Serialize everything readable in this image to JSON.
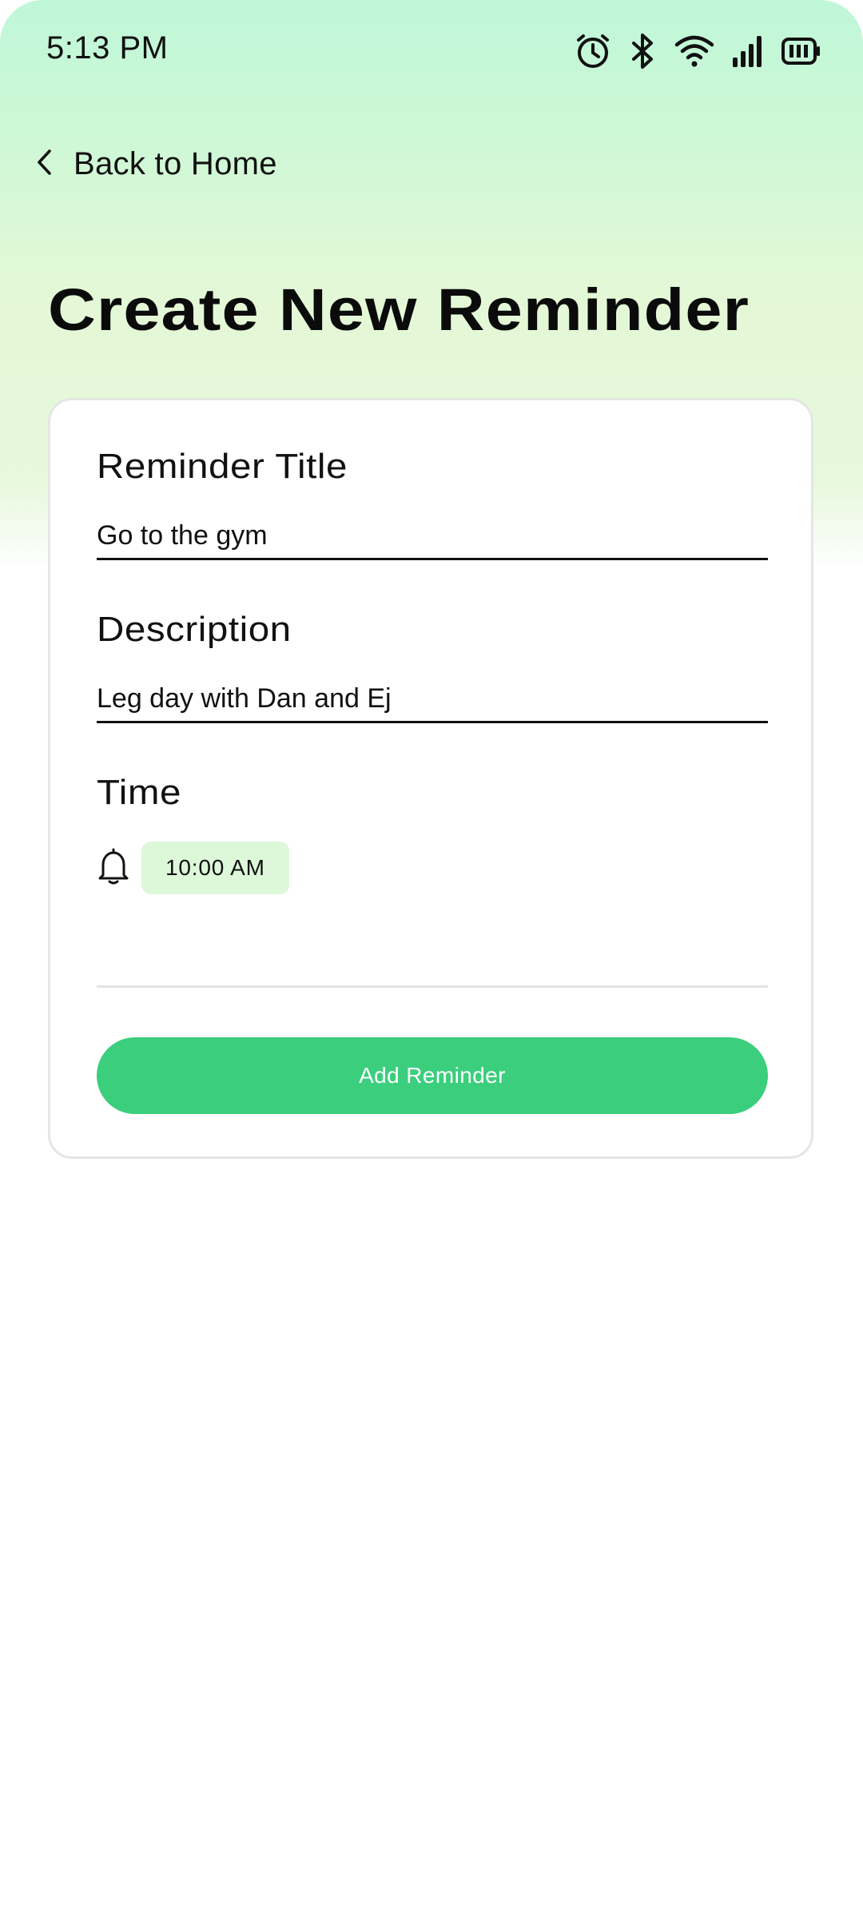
{
  "status_bar": {
    "time": "5:13 PM",
    "icons": [
      "alarm-icon",
      "bluetooth-icon",
      "wifi-icon",
      "signal-icon",
      "battery-icon"
    ]
  },
  "nav": {
    "back_label": "Back to Home",
    "back_icon": "chevron-left-icon"
  },
  "page": {
    "title": "Create New Reminder"
  },
  "form": {
    "title_label": "Reminder Title",
    "title_value": "Go to the gym",
    "description_label": "Description",
    "description_value": "Leg day with Dan and Ej",
    "time_label": "Time",
    "time_icon": "bell-icon",
    "time_value": "10:00 AM",
    "submit_label": "Add Reminder"
  },
  "colors": {
    "accent": "#3bce7d",
    "chip_background": "#dcf8d9",
    "header_gradient_top": "#bff7d8",
    "header_gradient_bottom": "#e7f8dc"
  }
}
